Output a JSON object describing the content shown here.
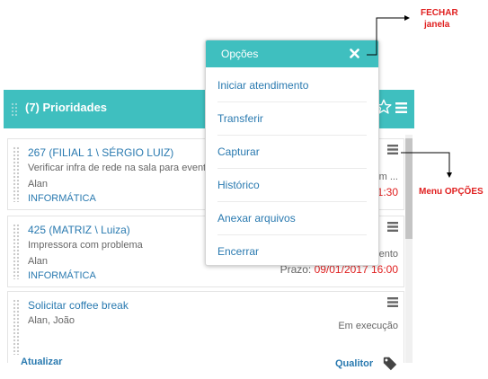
{
  "panel": {
    "title": "(7) Prioridades",
    "footer_left": "Atualizar",
    "footer_right": "Qualitor"
  },
  "cards": [
    {
      "title": "267 (FILIAL 1 \\ SÉRGIO LUIZ)",
      "description": "Verificar infra de rede na sala para evento",
      "people": "Alan",
      "category": "INFORMÁTICA",
      "status": "Em ...",
      "deadline_label": "",
      "deadline_value": "1:30"
    },
    {
      "title": "425 (MATRIZ \\ Luiza)",
      "description": "Impressora com problema",
      "people": "Alan",
      "category": "INFORMÁTICA",
      "status": "mento",
      "deadline_label": "Prazo: ",
      "deadline_value": "09/01/2017 16:00"
    },
    {
      "title": "Solicitar coffee break",
      "description": "",
      "people": "Alan, João",
      "category": "",
      "status": "Em execução",
      "deadline_label": "",
      "deadline_value": ""
    }
  ],
  "popup": {
    "title": "Opções",
    "items": [
      "Iniciar atendimento",
      "Transferir",
      "Capturar",
      "Histórico",
      "Anexar arquivos",
      "Encerrar"
    ]
  },
  "annotations": {
    "close_line1": "FECHAR",
    "close_line2": "janela",
    "menu": "Menu OPÇÕES"
  },
  "colors": {
    "accent": "#3fbfbf",
    "link": "#2a7ab0",
    "alert": "#e02020"
  },
  "icons": [
    "star-icon",
    "menu-icon",
    "close-icon",
    "tag-icon",
    "drag-handle-icon"
  ]
}
